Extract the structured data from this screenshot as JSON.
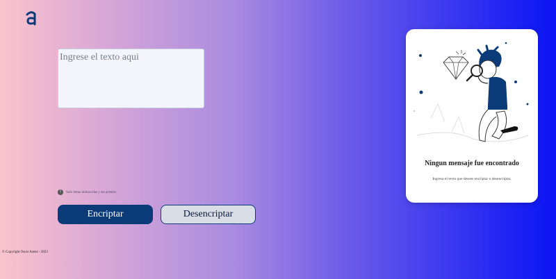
{
  "brand": {
    "logo_letter": "a"
  },
  "input": {
    "placeholder": "Ingrese el texto aqui"
  },
  "hint": {
    "text": "Solo letras minusculas y sin acentos",
    "icon": "info-icon"
  },
  "buttons": {
    "encrypt": "Encriptar",
    "decrypt": "Desencriptar"
  },
  "footer": {
    "copyright": "© Copyright Oscar Asenz - 2023"
  },
  "output": {
    "title": "Ningun mensaje fue encontrado",
    "subtitle": "Ingresa el texto que desees encriptar o desencriptar."
  },
  "colors": {
    "primary": "#0b3a78",
    "gradient_start": "#fbc4cc",
    "gradient_end": "#0a14f5"
  }
}
